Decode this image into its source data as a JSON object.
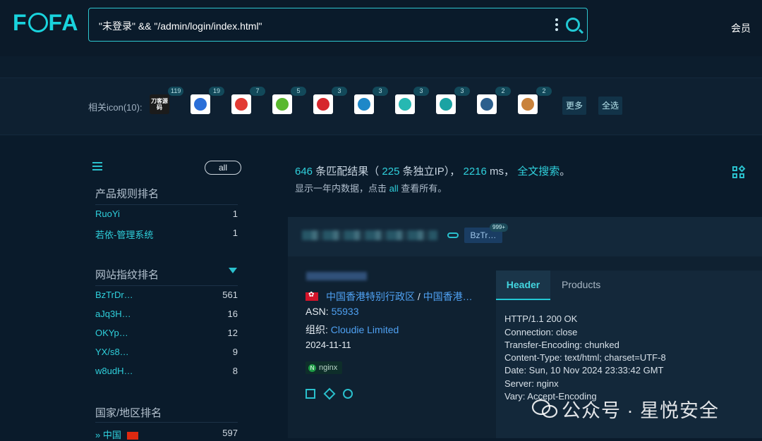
{
  "header": {
    "logo": "FOFA",
    "query": "\"未登录\" && \"/admin/login/index.html\"",
    "member_label": "会员"
  },
  "related_icons": {
    "label": "相关icon(10):",
    "icons": [
      {
        "name": "daoke-icon",
        "text": "刀客源码",
        "count": "119",
        "color": "#ffffff"
      },
      {
        "name": "compass-logo-icon",
        "count": "19",
        "color": "#2b6fd8"
      },
      {
        "name": "red-bag-icon",
        "count": "7",
        "color": "#e23b34"
      },
      {
        "name": "green-leaf-icon",
        "count": "5",
        "color": "#59b82f"
      },
      {
        "name": "red-circle-logo-icon",
        "count": "3",
        "color": "#d6272d"
      },
      {
        "name": "blue-bird-icon",
        "count": "3",
        "color": "#1e88c8"
      },
      {
        "name": "teal-circle-icon",
        "count": "3",
        "color": "#26b8b2"
      },
      {
        "name": "fingerprint-icon",
        "count": "3",
        "color": "#1aa3a3"
      },
      {
        "name": "bird-dark-icon",
        "count": "2",
        "color": "#2c5f8d"
      },
      {
        "name": "building-icon",
        "count": "2",
        "color": "#c9823b"
      }
    ],
    "more_label": "更多",
    "select_all_label": "全选"
  },
  "sidebar": {
    "all_label": "all",
    "product_title": "产品规则排名",
    "products": [
      {
        "name": "RuoYi",
        "count": "1"
      },
      {
        "name": "若依-管理系统",
        "count": "1"
      }
    ],
    "fingerprint_title": "网站指纹排名",
    "fingerprints": [
      {
        "name": "BzTrDr…",
        "count": "561"
      },
      {
        "name": "aJq3H…",
        "count": "16"
      },
      {
        "name": "OKYp…",
        "count": "12"
      },
      {
        "name": "YX/s8…",
        "count": "9"
      },
      {
        "name": "w8udH…",
        "count": "8"
      }
    ],
    "country_title": "国家/地区排名",
    "countries": [
      {
        "name": "中国",
        "count": "597"
      }
    ]
  },
  "summary": {
    "match_count": "646",
    "match_text": "条匹配结果",
    "open_paren": "（",
    "ip_count": "225",
    "ip_text": "条独立IP",
    "close_paren": "），",
    "ms": "2216",
    "ms_unit": "ms，",
    "fulltext_link": "全文搜索",
    "end": "。",
    "sub_prefix": "显示一年内数据，点击",
    "sub_link": "all",
    "sub_suffix": "查看所有。"
  },
  "result": {
    "tag_label": "BzTr…",
    "tag_badge": "999+",
    "location_region": "中国香港特别行政区",
    "location_sep": "/",
    "location_city": "中国香港…",
    "asn_label": "ASN:",
    "asn_value": "55933",
    "org_label": "组织:",
    "org_value": "Cloudie Limited",
    "date": "2024-11-11",
    "server_tag": "nginx",
    "tabs": [
      "Header",
      "Products"
    ],
    "header_lines": [
      "HTTP/1.1 200 OK",
      "Connection: close",
      "Transfer-Encoding: chunked",
      "Content-Type: text/html; charset=UTF-8",
      "Date: Sun, 10 Nov 2024 23:33:42 GMT",
      "Server: nginx",
      "Vary: Accept-Encoding"
    ]
  },
  "watermark": "公众号 · 星悦安全",
  "colors": {
    "accent": "#22c9d4",
    "link": "#4fa1f2",
    "background": "#0a1b2b"
  }
}
